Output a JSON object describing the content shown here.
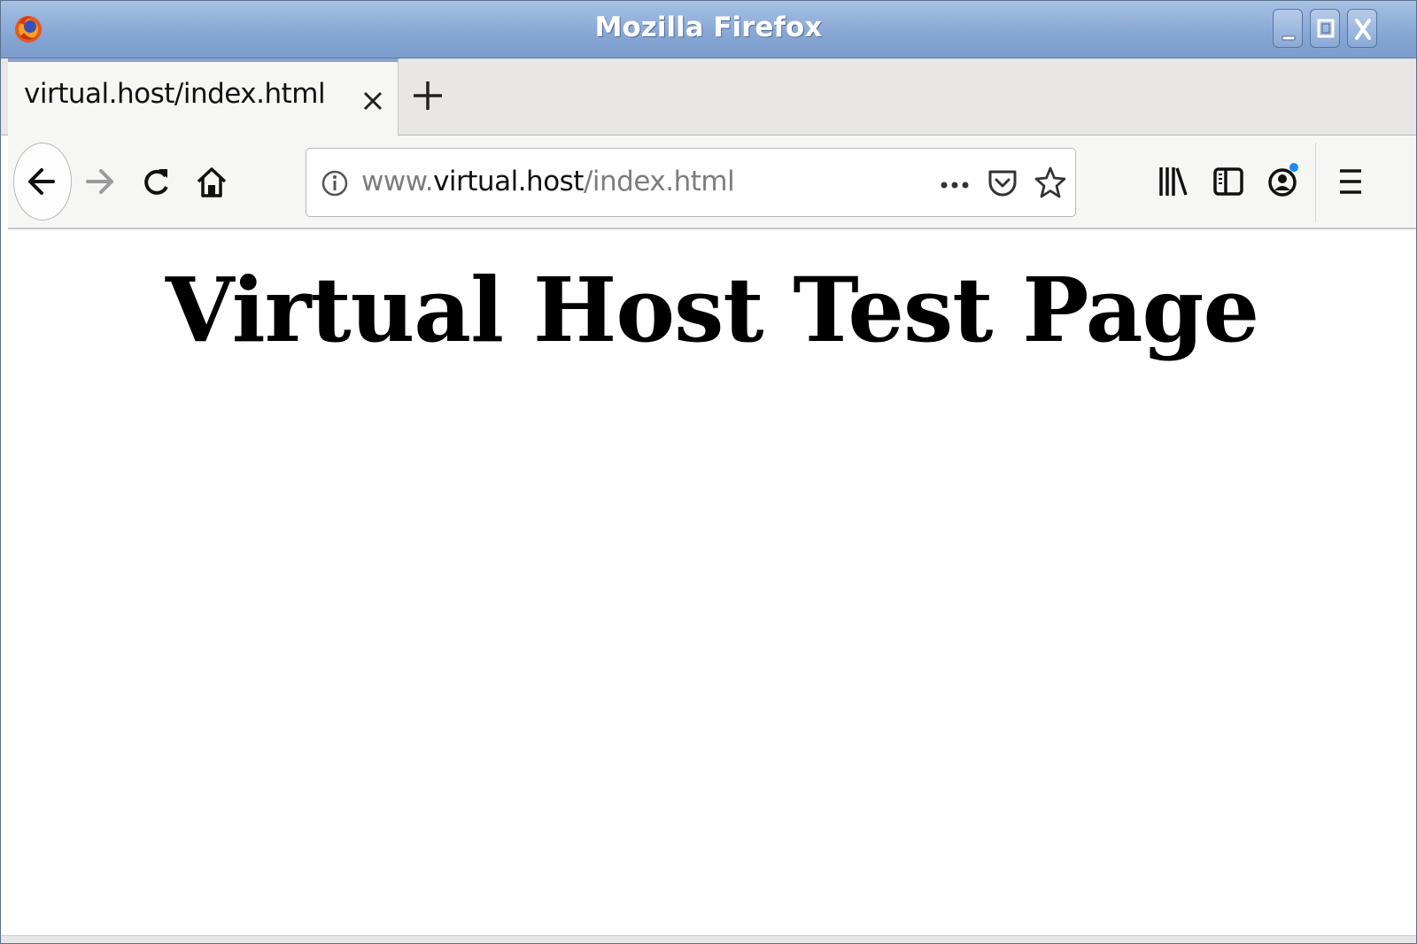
{
  "window": {
    "title": "Mozilla Firefox",
    "controls": [
      "minimize-icon",
      "maximize-icon",
      "close-icon"
    ],
    "accent_color": "#86a6d4"
  },
  "tabs": [
    {
      "label": "virtual.host/index.html",
      "active": true
    }
  ],
  "navbar": {
    "url": {
      "prefix": "www.",
      "host": "virtual.host",
      "path": "/index.html"
    },
    "icons": [
      "back-icon",
      "forward-icon",
      "reload-icon",
      "home-icon",
      "info-icon",
      "page-actions-icon",
      "pocket-icon",
      "bookmark-star-icon",
      "library-icon",
      "sidebar-icon",
      "account-icon",
      "menu-icon"
    ]
  },
  "page": {
    "heading": "Virtual Host Test Page"
  }
}
